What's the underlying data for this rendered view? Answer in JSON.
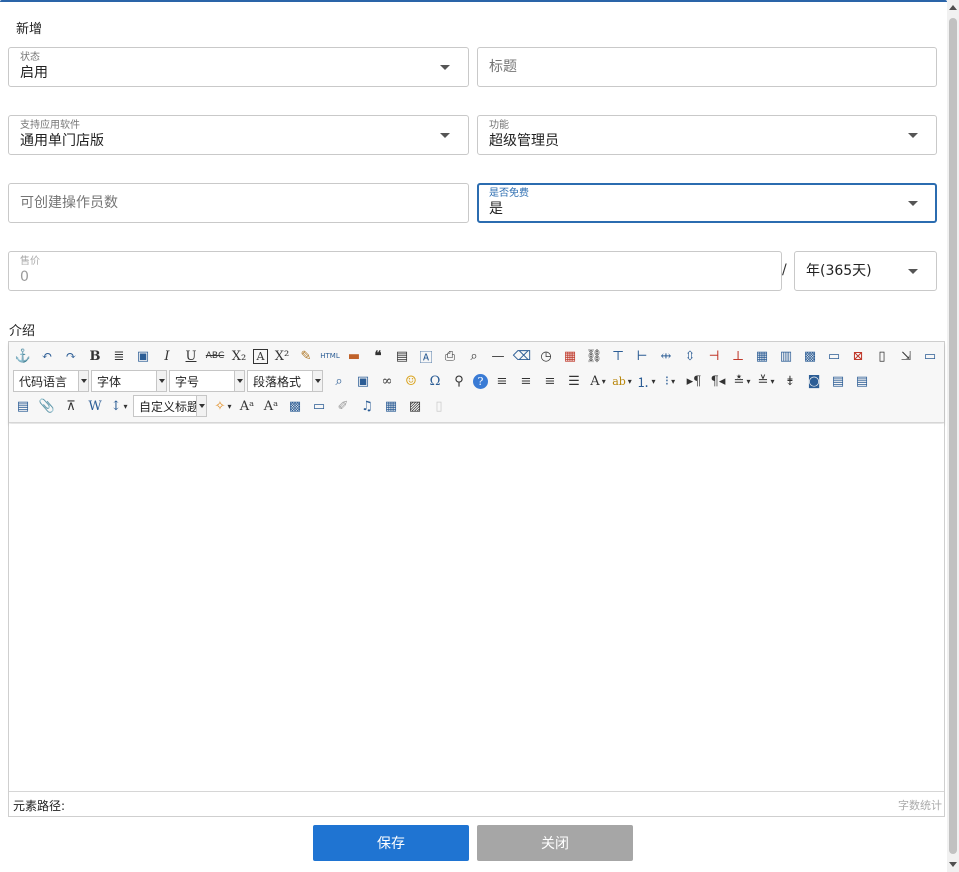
{
  "dialog": {
    "title": "新增"
  },
  "form": {
    "status": {
      "label": "状态",
      "value": "启用"
    },
    "title": {
      "placeholder": "标题"
    },
    "software": {
      "label": "支持应用软件",
      "value": "通用单门店版"
    },
    "function": {
      "label": "功能",
      "value": "超级管理员"
    },
    "operators": {
      "placeholder": "可创建操作员数"
    },
    "is_free": {
      "label": "是否免费",
      "value": "是"
    },
    "price": {
      "label": "售价",
      "value": "0"
    },
    "separator": "/",
    "period": {
      "value": "年(365天)"
    }
  },
  "intro": {
    "label": "介绍",
    "combos": {
      "code_language": "代码语言",
      "font_family": "字体",
      "font_size": "字号",
      "paragraph": "段落格式",
      "custom_heading": "自定义标题"
    },
    "toolbar_icons": {
      "row1": [
        "anchor-icon",
        "undo-icon",
        "redo-icon",
        "bold-icon",
        "format-match-icon",
        "insert-frame-icon",
        "italic-icon",
        "underline-icon",
        "strikethrough-icon",
        "subscript-icon",
        "text-border-icon",
        "superscript-icon",
        "clear-format-icon",
        "html-source-icon",
        "image-icon",
        "blockquote-icon",
        "template-icon",
        "attachment-doc-icon",
        "print-icon",
        "preview-icon",
        "horizontal-rule-icon",
        "eraser-icon",
        "time-icon",
        "date-icon",
        "link-chain-icon",
        "row-insert-icon",
        "col-insert-icon",
        "split-cols-icon",
        "split-rows-icon",
        "delete-col-icon",
        "delete-row-icon",
        "table-icon",
        "table-cols-icon",
        "table-grid-icon",
        "table-merge-icon",
        "table-delete-icon",
        "page-icon",
        "text-direction-icon",
        "fullscreen-icon"
      ],
      "row2": [
        "search-replace-icon",
        "image-insert-icon",
        "unlink-icon",
        "emoticon-icon",
        "special-char-icon",
        "find-icon",
        "help-icon",
        "align-left-icon",
        "align-center-icon",
        "align-right-icon",
        "align-justify-icon",
        "font-color-icon",
        "highlight-icon",
        "ordered-list-icon",
        "unordered-list-icon",
        "indent-icon",
        "ltr-icon",
        "line-spacing-icon",
        "row-spacing-icon",
        "page-break-icon",
        "snapscreen-icon",
        "wordimage-icon",
        "background-icon"
      ],
      "row3": [
        "insert-code-icon",
        "attach-icon",
        "scrawl-icon",
        "word-import-icon",
        "line-height-icon",
        "magic-wand-icon",
        "font-size-up-icon",
        "font-size-down-icon",
        "gallery-icon",
        "map-icon",
        "music-icon",
        "table-insert-icon",
        "paste-icon",
        "plain-paste-icon"
      ]
    },
    "status": {
      "path_label": "元素路径:",
      "word_count": "字数统计"
    }
  },
  "buttons": {
    "save": "保存",
    "close": "关闭"
  },
  "colors": {
    "primary": "#1f74d2",
    "disabled": "#a6a6a6",
    "focus": "#2b6cb0"
  }
}
